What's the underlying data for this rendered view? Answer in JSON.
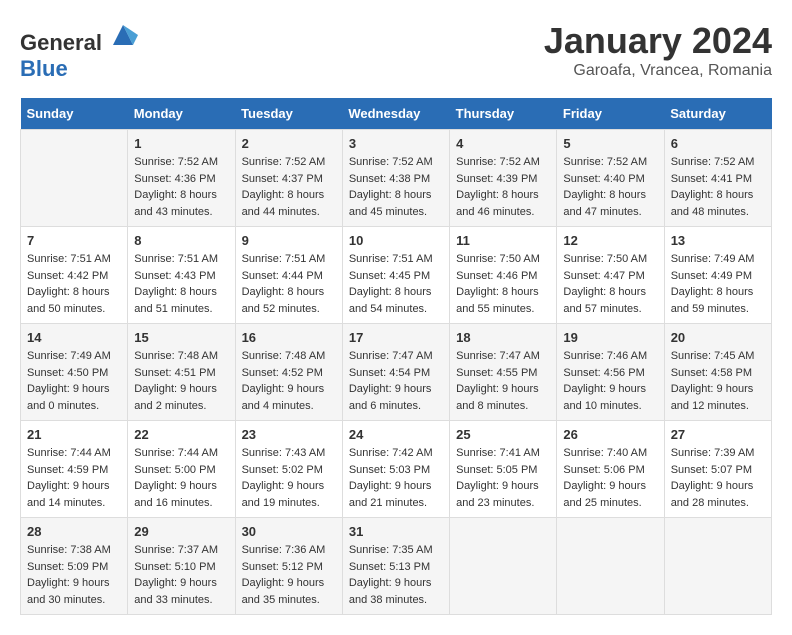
{
  "header": {
    "logo_general": "General",
    "logo_blue": "Blue",
    "month_title": "January 2024",
    "location": "Garoafa, Vrancea, Romania"
  },
  "days_of_week": [
    "Sunday",
    "Monday",
    "Tuesday",
    "Wednesday",
    "Thursday",
    "Friday",
    "Saturday"
  ],
  "weeks": [
    [
      {
        "day": "",
        "info": []
      },
      {
        "day": "1",
        "info": [
          "Sunrise: 7:52 AM",
          "Sunset: 4:36 PM",
          "Daylight: 8 hours",
          "and 43 minutes."
        ]
      },
      {
        "day": "2",
        "info": [
          "Sunrise: 7:52 AM",
          "Sunset: 4:37 PM",
          "Daylight: 8 hours",
          "and 44 minutes."
        ]
      },
      {
        "day": "3",
        "info": [
          "Sunrise: 7:52 AM",
          "Sunset: 4:38 PM",
          "Daylight: 8 hours",
          "and 45 minutes."
        ]
      },
      {
        "day": "4",
        "info": [
          "Sunrise: 7:52 AM",
          "Sunset: 4:39 PM",
          "Daylight: 8 hours",
          "and 46 minutes."
        ]
      },
      {
        "day": "5",
        "info": [
          "Sunrise: 7:52 AM",
          "Sunset: 4:40 PM",
          "Daylight: 8 hours",
          "and 47 minutes."
        ]
      },
      {
        "day": "6",
        "info": [
          "Sunrise: 7:52 AM",
          "Sunset: 4:41 PM",
          "Daylight: 8 hours",
          "and 48 minutes."
        ]
      }
    ],
    [
      {
        "day": "7",
        "info": [
          "Sunrise: 7:51 AM",
          "Sunset: 4:42 PM",
          "Daylight: 8 hours",
          "and 50 minutes."
        ]
      },
      {
        "day": "8",
        "info": [
          "Sunrise: 7:51 AM",
          "Sunset: 4:43 PM",
          "Daylight: 8 hours",
          "and 51 minutes."
        ]
      },
      {
        "day": "9",
        "info": [
          "Sunrise: 7:51 AM",
          "Sunset: 4:44 PM",
          "Daylight: 8 hours",
          "and 52 minutes."
        ]
      },
      {
        "day": "10",
        "info": [
          "Sunrise: 7:51 AM",
          "Sunset: 4:45 PM",
          "Daylight: 8 hours",
          "and 54 minutes."
        ]
      },
      {
        "day": "11",
        "info": [
          "Sunrise: 7:50 AM",
          "Sunset: 4:46 PM",
          "Daylight: 8 hours",
          "and 55 minutes."
        ]
      },
      {
        "day": "12",
        "info": [
          "Sunrise: 7:50 AM",
          "Sunset: 4:47 PM",
          "Daylight: 8 hours",
          "and 57 minutes."
        ]
      },
      {
        "day": "13",
        "info": [
          "Sunrise: 7:49 AM",
          "Sunset: 4:49 PM",
          "Daylight: 8 hours",
          "and 59 minutes."
        ]
      }
    ],
    [
      {
        "day": "14",
        "info": [
          "Sunrise: 7:49 AM",
          "Sunset: 4:50 PM",
          "Daylight: 9 hours",
          "and 0 minutes."
        ]
      },
      {
        "day": "15",
        "info": [
          "Sunrise: 7:48 AM",
          "Sunset: 4:51 PM",
          "Daylight: 9 hours",
          "and 2 minutes."
        ]
      },
      {
        "day": "16",
        "info": [
          "Sunrise: 7:48 AM",
          "Sunset: 4:52 PM",
          "Daylight: 9 hours",
          "and 4 minutes."
        ]
      },
      {
        "day": "17",
        "info": [
          "Sunrise: 7:47 AM",
          "Sunset: 4:54 PM",
          "Daylight: 9 hours",
          "and 6 minutes."
        ]
      },
      {
        "day": "18",
        "info": [
          "Sunrise: 7:47 AM",
          "Sunset: 4:55 PM",
          "Daylight: 9 hours",
          "and 8 minutes."
        ]
      },
      {
        "day": "19",
        "info": [
          "Sunrise: 7:46 AM",
          "Sunset: 4:56 PM",
          "Daylight: 9 hours",
          "and 10 minutes."
        ]
      },
      {
        "day": "20",
        "info": [
          "Sunrise: 7:45 AM",
          "Sunset: 4:58 PM",
          "Daylight: 9 hours",
          "and 12 minutes."
        ]
      }
    ],
    [
      {
        "day": "21",
        "info": [
          "Sunrise: 7:44 AM",
          "Sunset: 4:59 PM",
          "Daylight: 9 hours",
          "and 14 minutes."
        ]
      },
      {
        "day": "22",
        "info": [
          "Sunrise: 7:44 AM",
          "Sunset: 5:00 PM",
          "Daylight: 9 hours",
          "and 16 minutes."
        ]
      },
      {
        "day": "23",
        "info": [
          "Sunrise: 7:43 AM",
          "Sunset: 5:02 PM",
          "Daylight: 9 hours",
          "and 19 minutes."
        ]
      },
      {
        "day": "24",
        "info": [
          "Sunrise: 7:42 AM",
          "Sunset: 5:03 PM",
          "Daylight: 9 hours",
          "and 21 minutes."
        ]
      },
      {
        "day": "25",
        "info": [
          "Sunrise: 7:41 AM",
          "Sunset: 5:05 PM",
          "Daylight: 9 hours",
          "and 23 minutes."
        ]
      },
      {
        "day": "26",
        "info": [
          "Sunrise: 7:40 AM",
          "Sunset: 5:06 PM",
          "Daylight: 9 hours",
          "and 25 minutes."
        ]
      },
      {
        "day": "27",
        "info": [
          "Sunrise: 7:39 AM",
          "Sunset: 5:07 PM",
          "Daylight: 9 hours",
          "and 28 minutes."
        ]
      }
    ],
    [
      {
        "day": "28",
        "info": [
          "Sunrise: 7:38 AM",
          "Sunset: 5:09 PM",
          "Daylight: 9 hours",
          "and 30 minutes."
        ]
      },
      {
        "day": "29",
        "info": [
          "Sunrise: 7:37 AM",
          "Sunset: 5:10 PM",
          "Daylight: 9 hours",
          "and 33 minutes."
        ]
      },
      {
        "day": "30",
        "info": [
          "Sunrise: 7:36 AM",
          "Sunset: 5:12 PM",
          "Daylight: 9 hours",
          "and 35 minutes."
        ]
      },
      {
        "day": "31",
        "info": [
          "Sunrise: 7:35 AM",
          "Sunset: 5:13 PM",
          "Daylight: 9 hours",
          "and 38 minutes."
        ]
      },
      {
        "day": "",
        "info": []
      },
      {
        "day": "",
        "info": []
      },
      {
        "day": "",
        "info": []
      }
    ]
  ]
}
